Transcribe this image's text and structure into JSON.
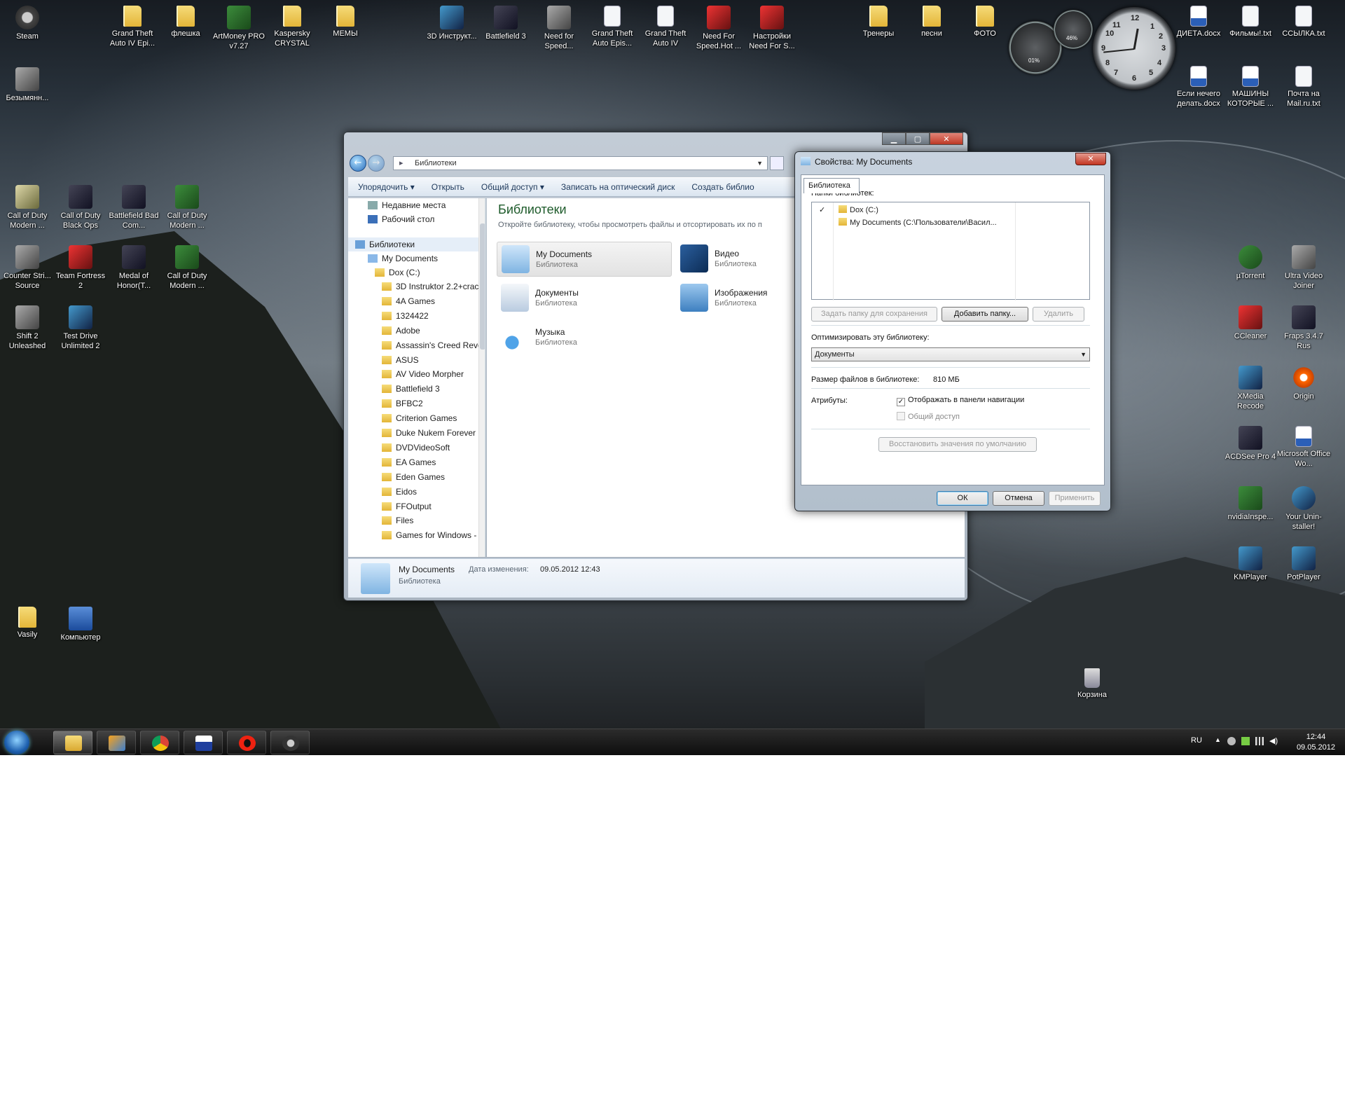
{
  "desktop": {
    "icons_top": [
      {
        "label": "Steam",
        "icon": "steam-icon"
      },
      {
        "label": "Grand Theft Auto IV Epi...",
        "icon": "folder-icon"
      },
      {
        "label": "флешка",
        "icon": "folder-icon"
      },
      {
        "label": "ArtMoney PRO v7.27",
        "icon": "artmoney-icon"
      },
      {
        "label": "Kaspersky CRYSTAL",
        "icon": "folder-icon"
      },
      {
        "label": "МЕМЫ",
        "icon": "folder-icon"
      },
      {
        "label": "3D Инструкт...",
        "icon": "3d-instruktor-icon"
      },
      {
        "label": "Battlefield 3",
        "icon": "battlefield-icon"
      },
      {
        "label": "Need for Speed...",
        "icon": "nfs-icon"
      },
      {
        "label": "Grand Theft Auto Epis...",
        "icon": "gta-icon"
      },
      {
        "label": "Grand Theft Auto IV",
        "icon": "gta-icon"
      },
      {
        "label": "Need For Speed.Hot ...",
        "icon": "nfs-icon"
      },
      {
        "label": "Настройки Need For S...",
        "icon": "nfs-icon"
      },
      {
        "label": "Тренеры",
        "icon": "folder-icon"
      },
      {
        "label": "песни",
        "icon": "folder-icon"
      },
      {
        "label": "ФОТО",
        "icon": "folder-icon"
      },
      {
        "label": "ДИЕТА.docx",
        "icon": "word-doc-icon"
      },
      {
        "label": "Фильмы!.txt",
        "icon": "text-file-icon"
      },
      {
        "label": "ССЫЛКА.txt",
        "icon": "text-file-icon"
      },
      {
        "label": "Безымянн...",
        "icon": "image-file-icon"
      },
      {
        "label": "Если нечего делать.docx",
        "icon": "word-doc-icon"
      },
      {
        "label": "МАШИНЫ КОТОРЫЕ ...",
        "icon": "word-doc-icon"
      },
      {
        "label": "Почта на Mail.ru.txt",
        "icon": "text-file-icon"
      }
    ],
    "icons_left": [
      {
        "label": "Call of Duty Modern ...",
        "icon": "cod-icon"
      },
      {
        "label": "Call of Duty Black Ops",
        "icon": "cod-blackops-icon"
      },
      {
        "label": "Battlefield Bad Com...",
        "icon": "battlefield-icon"
      },
      {
        "label": "Call of Duty Modern ...",
        "icon": "cod-mw3-icon"
      },
      {
        "label": "Counter Stri... Source",
        "icon": "counter-strike-icon"
      },
      {
        "label": "Team Fortress 2",
        "icon": "tf2-icon"
      },
      {
        "label": "Medal of Honor(T...",
        "icon": "moh-icon"
      },
      {
        "label": "Call of Duty Modern ...",
        "icon": "cod-mw3-icon"
      },
      {
        "label": "Shift 2 Unleashed",
        "icon": "shift2-icon"
      },
      {
        "label": "Test Drive Unlimited 2",
        "icon": "tdu2-icon"
      },
      {
        "label": "Vasily",
        "icon": "user-folder-icon"
      },
      {
        "label": "Компьютер",
        "icon": "computer-icon"
      }
    ],
    "icons_right": [
      {
        "label": "µTorrent",
        "icon": "utorrent-icon"
      },
      {
        "label": "Ultra Video Joiner",
        "icon": "video-joiner-icon"
      },
      {
        "label": "CCleaner",
        "icon": "ccleaner-icon"
      },
      {
        "label": "Fraps 3.4.7 Rus",
        "icon": "fraps-icon"
      },
      {
        "label": "XMedia Recode",
        "icon": "xmedia-icon"
      },
      {
        "label": "Origin",
        "icon": "origin-icon"
      },
      {
        "label": "ACDSee Pro 4",
        "icon": "acdsee-icon"
      },
      {
        "label": "Microsoft Office Wo...",
        "icon": "word-icon"
      },
      {
        "label": "nvidiaInspe...",
        "icon": "nvidia-icon"
      },
      {
        "label": "Your Unin-staller!",
        "icon": "uninstaller-icon"
      },
      {
        "label": "KMPlayer",
        "icon": "kmplayer-icon"
      },
      {
        "label": "PotPlayer",
        "icon": "potplayer-icon"
      },
      {
        "label": "Корзина",
        "icon": "recycle-bin-icon"
      }
    ],
    "gadget": {
      "cpu": "01%",
      "mem": "46%"
    }
  },
  "taskbar": {
    "apps": [
      "explorer-icon",
      "media-player-icon",
      "chrome-icon",
      "floppy-icon",
      "opera-icon",
      "steam-icon"
    ],
    "lang": "RU",
    "time": "12:44",
    "date": "09.05.2012"
  },
  "explorer": {
    "address": "Библиотеки",
    "commands": [
      "Упорядочить ▾",
      "Открыть",
      "Общий доступ ▾",
      "Записать на оптический диск",
      "Создать библио"
    ],
    "nav_top": [
      "Недавние места",
      "Рабочий стол"
    ],
    "nav_libraries": "Библиотеки",
    "nav_mydocs": "My Documents",
    "nav_drive": "Dox (C:)",
    "folders": [
      "3D Instruktor 2.2+crac",
      "4A Games",
      "1324422",
      "Adobe",
      "Assassin's Creed Revel",
      "ASUS",
      "AV Video Morpher",
      "Battlefield 3",
      "BFBC2",
      "Criterion Games",
      "Duke Nukem Forever",
      "DVDVideoSoft",
      "EA Games",
      "Eden Games",
      "Eidos",
      "FFOutput",
      "Files",
      "Games for Windows -"
    ],
    "title": "Библиотеки",
    "subtitle": "Откройте библиотеку, чтобы просмотреть файлы и отсортировать их по п",
    "libraries": [
      {
        "name": "My Documents",
        "type": "Библиотека"
      },
      {
        "name": "Видео",
        "type": "Библиотека"
      },
      {
        "name": "Документы",
        "type": "Библиотека"
      },
      {
        "name": "Изображения",
        "type": "Библиотека"
      },
      {
        "name": "Музыка",
        "type": "Библиотека"
      }
    ],
    "details": {
      "name": "My Documents",
      "modified_label": "Дата изменения:",
      "modified": "09.05.2012 12:43",
      "type": "Библиотека"
    }
  },
  "dialog": {
    "title": "Свойства: My Documents",
    "tab": "Библиотека",
    "folders_label": "Папки библиотек:",
    "folders": [
      {
        "check": "✓",
        "name": "Dox (C:)"
      },
      {
        "check": "",
        "name": "My Documents (C:\\Пользователи\\Васил..."
      }
    ],
    "set_save_folder": "Задать папку для сохранения",
    "add_folder": "Добавить папку...",
    "remove": "Удалить",
    "optimize_label": "Оптимизировать эту библиотеку:",
    "optimize_value": "Документы",
    "size_label": "Размер файлов в библиотеке:",
    "size_value": "810 МБ",
    "attributes_label": "Атрибуты:",
    "show_in_nav": "Отображать в панели навигации",
    "shared": "Общий доступ",
    "restore_defaults": "Восстановить значения по умолчанию",
    "ok": "ОК",
    "cancel": "Отмена",
    "apply": "Применить"
  }
}
